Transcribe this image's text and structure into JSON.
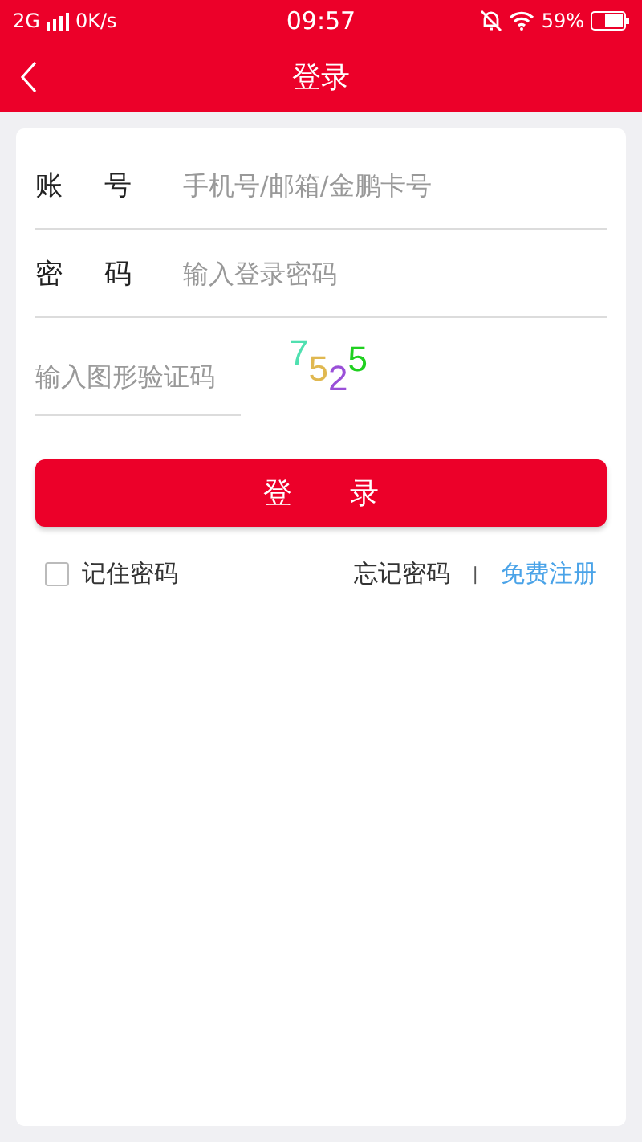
{
  "status_bar": {
    "network": "2G",
    "speed": "0K/s",
    "time": "09:57",
    "battery": "59%"
  },
  "nav": {
    "back": true,
    "title": "登录"
  },
  "fields": [
    {
      "label": "账 号",
      "placeholder": "手机号/邮箱/金鹏卡号"
    },
    {
      "label": "密 码",
      "placeholder": "输入登录密码"
    }
  ],
  "captcha": {
    "placeholder": "输入图形验证码",
    "chars": [
      {
        "text": "7",
        "color": "#4fe0b0"
      },
      {
        "text": "5",
        "color": "#e0b850"
      },
      {
        "text": "2",
        "color": "#9a50d8"
      },
      {
        "text": "5",
        "color": "#20d020"
      }
    ]
  },
  "login_button": "登 录",
  "remember": {
    "label": "记住密码",
    "checked": false
  },
  "forgot": "忘记密码",
  "separator": "|",
  "register": "免费注册"
}
